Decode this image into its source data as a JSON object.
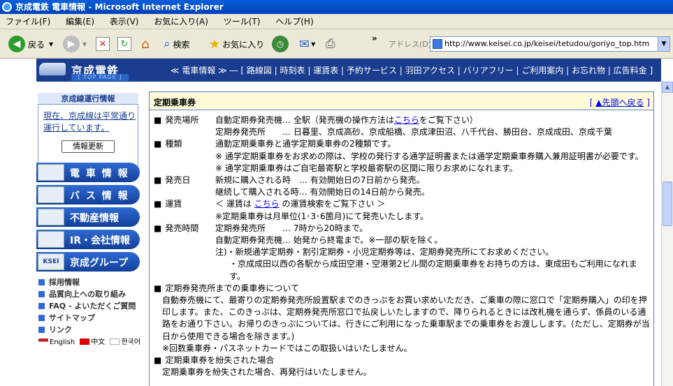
{
  "window": {
    "title": "京成電鉄 電車情報 - Microsoft Internet Explorer"
  },
  "menu": [
    "ファイル(F)",
    "編集(E)",
    "表示(V)",
    "お気に入り(A)",
    "ツール(T)",
    "ヘルプ(H)"
  ],
  "toolbar": {
    "back": "戻る",
    "search": "検索",
    "favorites": "お気に入り",
    "more": "»"
  },
  "address": {
    "label": "アドレス(D)",
    "url": "http://www.keisei.co.jp/keisei/tetudou/goriyo_top.htm"
  },
  "header": {
    "logo": "京成電鉄",
    "top_page": "[ TOP PAGE ]",
    "nav": "≪ 電車情報 ≫ ― [ 路線図 | 時刻表 | 運賃表 | 予約サービス | 羽田アクセス | バリアフリー | ご利用案内 | お忘れ物 | 広告料金 ]"
  },
  "sidebar": {
    "status_title": "京成線運行情報",
    "status_text": "現在、京成線は平常通り運行しています。",
    "refresh": "情報更新",
    "menu": [
      "電 車 情 報",
      "バ ス 情 報",
      "不動産情報",
      "IR・会社情報",
      "京成グループ"
    ],
    "links": [
      "採用情報",
      "品質向上への取り組み",
      "FAQ - よいただくご質問",
      "サイトマップ",
      "リンク"
    ],
    "langs": [
      "English",
      "中文",
      "한국어"
    ]
  },
  "content": {
    "title": "定期乗車券",
    "back_link": "▲先頭へ戻る",
    "sales_place": {
      "label": "発売場所",
      "l1a": "自動定期券発売機… 全駅（発売機の操作方法は",
      "l1link": "こちら",
      "l1b": "をご覧下さい）",
      "l2": "定期券発売所　　… 日暮里、京成高砂、京成船橋、京成津田沼、八千代台、勝田台、京成成田、京成千葉"
    },
    "types": {
      "label": "種類",
      "l1": "通勤定期乗車券と通学定期乗車券の2種類です。",
      "l2": "※ 通学定期乗車券をお求めの際は、学校の発行する通学証明書または通学定期乗車券購入兼用証明書が必要です。",
      "l3": "※ 通学定期乗車券はご自宅最寄駅と学校最寄駅の区間に限りお求めになれます。"
    },
    "sale_date": {
      "label": "発売日",
      "l1": "新規に購入される時　… 有効開始日の7日前から発売。",
      "l2": "継続して購入される時… 有効開始日の14日前から発売。"
    },
    "fare": {
      "label": "運賃",
      "l1a": "＜ 運賃は ",
      "l1link": "こちら",
      "l1b": " の運賃検索をご覧下さい ＞",
      "l2": "※定期乗車券は月単位(1･3･6箇月)にて発売いたします。"
    },
    "hours": {
      "label": "発売時間",
      "l1": "定期券発売所　　… 7時から20時まで。",
      "l2": "自動定期券発売機… 始発から終電まで。※一部の駅を除く。",
      "l3": "注)・新規通学定期券・割引定期券・小児定期券等は、定期券発売所にてお求めください。",
      "l4": "・京成成田以西の各駅から成田空港・空港第2ビル間の定期乗車券をお持ちの方は、東成田もご利用になれます。"
    },
    "outside": {
      "title": "定期券発売所までの乗車券について",
      "text": "自動券売機にて、最寄りの定期券発売所設置駅までのきっぷをお買い求めいただき、ご乗車の際に窓口で「定期券購入」の印を押印します。また、このきっぷは、定期券発売所窓口で払戻しいたしますので、降りられるときには改札機を通らず、係員のいる通路をお通り下さい。お帰りのきっぷについては、行きにご利用になった乗車駅までの乗車券をお渡しします。(ただし、定期券が当日から使用できる場合を除きます。)",
      "note": "※回数乗車券・パスネットカードではこの取扱いはいたしません。"
    },
    "lost": {
      "title": "定期乗車券を紛失された場合",
      "text": "定期乗車券を紛失された場合、再発行はいたしません。"
    }
  }
}
